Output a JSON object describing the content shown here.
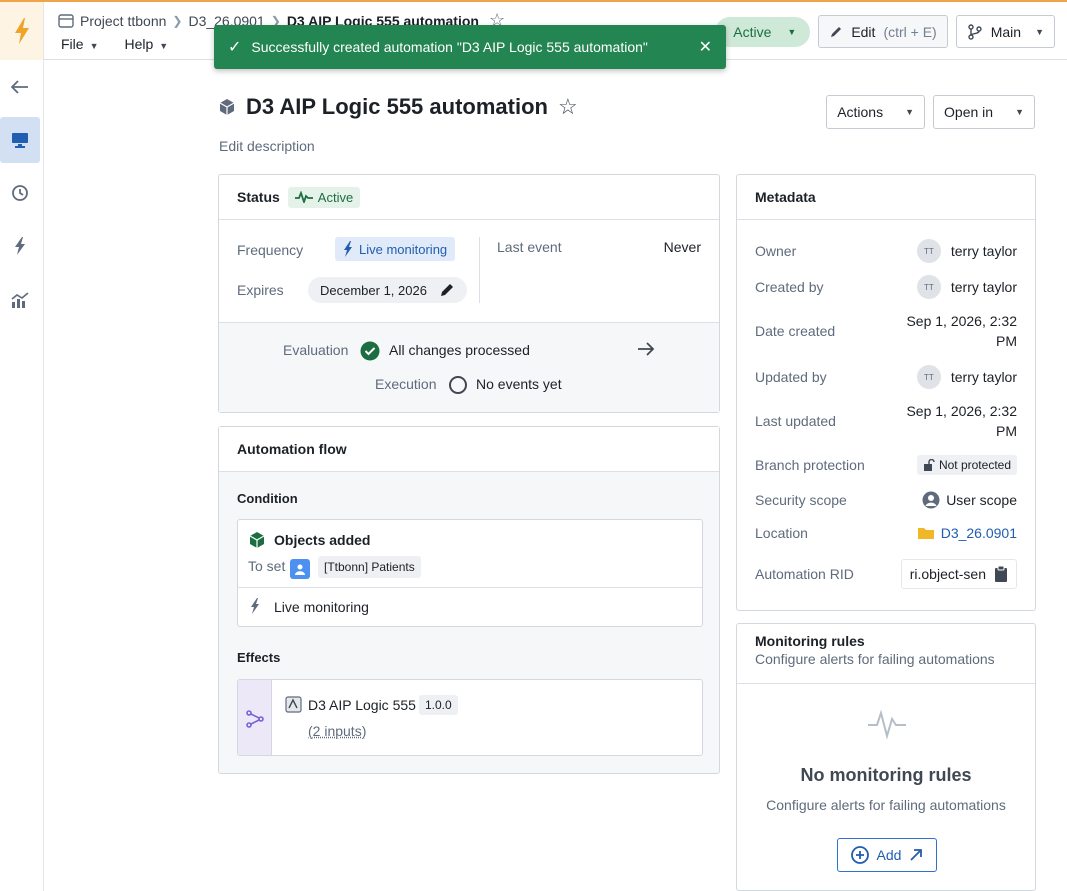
{
  "breadcrumb": {
    "project": "Project ttbonn",
    "folder": "D3_26.0901",
    "current": "D3 AIP Logic 555 automation"
  },
  "menus": {
    "file": "File",
    "help": "Help"
  },
  "toolbar": {
    "status": "Active",
    "edit_label": "Edit",
    "edit_shortcut": "(ctrl + E)",
    "branch_label": "Main"
  },
  "toast": {
    "message": "Successfully created automation \"D3 AIP Logic 555 automation\""
  },
  "page": {
    "title": "D3 AIP Logic 555 automation",
    "edit_description": "Edit description",
    "actions_label": "Actions",
    "open_in_label": "Open in"
  },
  "status_card": {
    "title": "Status",
    "badge": "Active",
    "frequency_label": "Frequency",
    "frequency_value": "Live monitoring",
    "expires_label": "Expires",
    "expires_value": "December 1, 2026",
    "last_event_label": "Last event",
    "last_event_value": "Never",
    "evaluation_label": "Evaluation",
    "evaluation_value": "All changes processed",
    "execution_label": "Execution",
    "execution_value": "No events yet"
  },
  "flow_card": {
    "title": "Automation flow",
    "condition_label": "Condition",
    "condition_title": "Objects added",
    "to_set_label": "To set",
    "object_set": "[Ttbonn] Patients",
    "monitoring": "Live monitoring",
    "effects_label": "Effects",
    "effect_name": "D3 AIP Logic 555",
    "effect_version": "1.0.0",
    "effect_inputs": "(2 inputs)"
  },
  "metadata": {
    "title": "Metadata",
    "owner_label": "Owner",
    "owner_initials": "TT",
    "owner": "terry taylor",
    "created_by_label": "Created by",
    "created_by_initials": "TT",
    "created_by": "terry taylor",
    "date_created_label": "Date created",
    "date_created_l1": "Sep 1, 2026, 2:32",
    "date_created_l2": "PM",
    "updated_by_label": "Updated by",
    "updated_by_initials": "TT",
    "updated_by": "terry taylor",
    "last_updated_label": "Last updated",
    "last_updated_l1": "Sep 1, 2026, 2:32",
    "last_updated_l2": "PM",
    "branch_protection_label": "Branch protection",
    "branch_protection": "Not protected",
    "security_scope_label": "Security scope",
    "security_scope": "User scope",
    "location_label": "Location",
    "location": "D3_26.0901",
    "rid_label": "Automation RID",
    "rid": "ri.object-sen"
  },
  "monitoring": {
    "title": "Monitoring rules",
    "subtitle": "Configure alerts for failing automations",
    "empty_title": "No monitoring rules",
    "empty_subtitle": "Configure alerts for failing automations",
    "add_label": "Add"
  },
  "colors": {
    "accent_green": "#238551",
    "accent_blue": "#2d72d2",
    "brand_orange": "#f0a44a"
  }
}
